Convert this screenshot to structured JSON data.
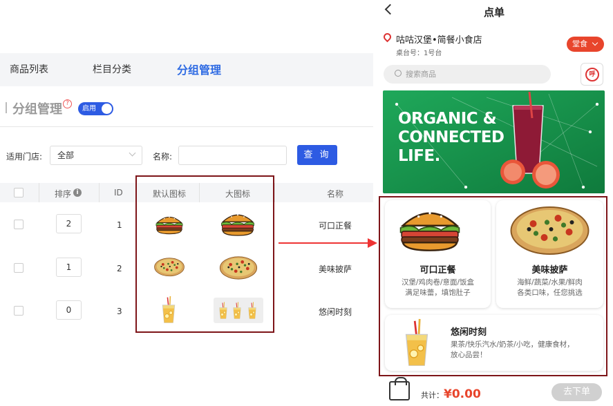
{
  "tabs": [
    {
      "label": "商品列表"
    },
    {
      "label": "栏目分类"
    },
    {
      "label": "分组管理",
      "active": true
    }
  ],
  "section": {
    "title": "分组管理",
    "help_glyph": "?",
    "toggle_label": "启用",
    "toggle_on": true
  },
  "filters": {
    "store_label": "适用门店:",
    "store_value": "全部",
    "name_label": "名称:",
    "name_value": "",
    "query_label": "查 询"
  },
  "table": {
    "headers": {
      "sort": "排序",
      "info_glyph": "i",
      "id": "ID",
      "default_icon": "默认图标",
      "big_icon": "大图标",
      "name": "名称"
    },
    "rows": [
      {
        "sort": "2",
        "id": "1",
        "name": "可口正餐",
        "icon": "burger-icon"
      },
      {
        "sort": "1",
        "id": "2",
        "name": "美味披萨",
        "icon": "pizza-icon"
      },
      {
        "sort": "0",
        "id": "3",
        "name": "悠闲时刻",
        "icon": "drink-icon"
      }
    ]
  },
  "phone": {
    "title": "点单",
    "store_name": "咕咕汉堡•简餐小食店",
    "table_no": "桌台号：1号台",
    "dine_mode": "堂食",
    "search_placeholder": "搜索商品",
    "call_label": "呼",
    "banner_line1": "ORGANIC &",
    "banner_line2": "CONNECTED",
    "banner_line3": "LIFE.",
    "cards": [
      {
        "title": "可口正餐",
        "desc1": "汉堡/鸡肉卷/意面/饭盒",
        "desc2": "满足味蕾，填饱肚子"
      },
      {
        "title": "美味披萨",
        "desc1": "海鲜/蔬菜/水果/鲜肉",
        "desc2": "各类口味，任您挑选"
      },
      {
        "title": "悠闲时刻",
        "desc1": "果茶/快乐汽水/奶茶/小吃，健康食材，",
        "desc2": "放心品尝！"
      }
    ],
    "total_label": "共计：",
    "total_value": "¥0.00",
    "order_button": "去下单"
  },
  "colors": {
    "accent": "#2d5be3",
    "highlight_box": "#7d1418",
    "arrow": "#e33333",
    "order_orange": "#e8452c"
  }
}
